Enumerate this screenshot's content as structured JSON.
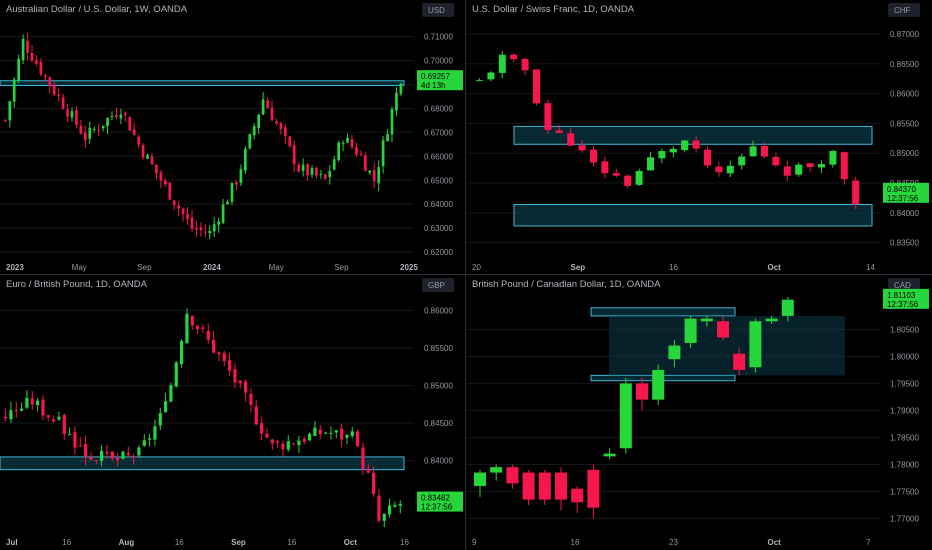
{
  "colors": {
    "up": "#26d63a",
    "down": "#f7164d",
    "zone_fill": "#0d4a5a",
    "zone_stroke": "#3fb8d8",
    "grid": "#14161c"
  },
  "charts": [
    {
      "title": "Australian Dollar / U.S. Dollar, 1W, OANDA",
      "currency": "USD",
      "yticks": [
        "0.71000",
        "0.70000",
        "0.69000",
        "0.68000",
        "0.67000",
        "0.66000",
        "0.65000",
        "0.64000",
        "0.63000",
        "0.62000"
      ],
      "ymin": 0.618,
      "ymax": 0.716,
      "xlabels": [
        {
          "t": "2023",
          "bold": true
        },
        {
          "t": "May"
        },
        {
          "t": "Sep"
        },
        {
          "t": "2024",
          "bold": true
        },
        {
          "t": "May"
        },
        {
          "t": "Sep"
        },
        {
          "t": "2025",
          "bold": true
        }
      ],
      "last_price": "0.69257",
      "countdown": "4d 13h",
      "zones": [
        {
          "from": 0.6895,
          "to": 0.6915
        }
      ],
      "seed": 7,
      "n": 90,
      "anchors": [
        [
          0,
          0.675
        ],
        [
          4,
          0.708
        ],
        [
          10,
          0.69
        ],
        [
          18,
          0.668
        ],
        [
          26,
          0.68
        ],
        [
          30,
          0.665
        ],
        [
          35,
          0.65
        ],
        [
          42,
          0.63
        ],
        [
          46,
          0.628
        ],
        [
          52,
          0.65
        ],
        [
          58,
          0.684
        ],
        [
          62,
          0.67
        ],
        [
          66,
          0.655
        ],
        [
          72,
          0.65
        ],
        [
          76,
          0.668
        ],
        [
          80,
          0.66
        ],
        [
          83,
          0.65
        ],
        [
          86,
          0.672
        ],
        [
          89,
          0.693
        ]
      ]
    },
    {
      "title": "U.S. Dollar / Swiss Franc, 1D, OANDA",
      "currency": "CHF",
      "yticks": [
        "0.87000",
        "0.86500",
        "0.86000",
        "0.85500",
        "0.85000",
        "0.84500",
        "0.84000",
        "0.83500"
      ],
      "ymin": 0.8326,
      "ymax": 0.872,
      "xlabels": [
        {
          "t": "20"
        },
        {
          "t": "Sep",
          "bold": true
        },
        {
          "t": "16"
        },
        {
          "t": "Oct",
          "bold": true
        },
        {
          "t": "14"
        }
      ],
      "last_price": "0.84370",
      "countdown": "12:37:56",
      "zones": [
        {
          "from": 0.8515,
          "to": 0.8545
        },
        {
          "from": 0.8378,
          "to": 0.8414
        }
      ],
      "seed": 11,
      "n": 34,
      "anchors": [
        [
          0,
          0.862
        ],
        [
          2,
          0.866
        ],
        [
          4,
          0.864
        ],
        [
          6,
          0.854
        ],
        [
          8,
          0.852
        ],
        [
          10,
          0.848
        ],
        [
          13,
          0.845
        ],
        [
          15,
          0.849
        ],
        [
          18,
          0.852
        ],
        [
          21,
          0.846
        ],
        [
          24,
          0.851
        ],
        [
          27,
          0.847
        ],
        [
          29,
          0.848
        ],
        [
          31,
          0.85
        ],
        [
          33,
          0.842
        ],
        [
          34,
          0.8437
        ]
      ]
    },
    {
      "title": "Euro / British Pound, 1D, OANDA",
      "currency": "GBP",
      "yticks": [
        "0.86000",
        "0.85500",
        "0.85000",
        "0.84500",
        "0.84000"
      ],
      "ymin": 0.8305,
      "ymax": 0.8618,
      "xlabels": [
        {
          "t": "Jul",
          "bold": true
        },
        {
          "t": "16"
        },
        {
          "t": "Aug",
          "bold": true
        },
        {
          "t": "16"
        },
        {
          "t": "Sep",
          "bold": true
        },
        {
          "t": "16"
        },
        {
          "t": "Oct",
          "bold": true
        },
        {
          "t": "16"
        }
      ],
      "last_price": "0.83482",
      "countdown": "12:37:56",
      "zones": [
        {
          "from": 0.8388,
          "to": 0.8405
        }
      ],
      "seed": 3,
      "n": 75,
      "anchors": [
        [
          0,
          0.846
        ],
        [
          5,
          0.848
        ],
        [
          10,
          0.845
        ],
        [
          15,
          0.841
        ],
        [
          20,
          0.84
        ],
        [
          25,
          0.841
        ],
        [
          30,
          0.847
        ],
        [
          34,
          0.86
        ],
        [
          38,
          0.856
        ],
        [
          42,
          0.852
        ],
        [
          46,
          0.847
        ],
        [
          50,
          0.842
        ],
        [
          55,
          0.843
        ],
        [
          60,
          0.844
        ],
        [
          65,
          0.843
        ],
        [
          68,
          0.838
        ],
        [
          70,
          0.832
        ],
        [
          73,
          0.834
        ],
        [
          75,
          0.8348
        ]
      ]
    },
    {
      "title": "British Pound / Canadian Dollar, 1D, OANDA",
      "currency": "CAD",
      "yticks": [
        "1.80500",
        "1.80000",
        "1.79500",
        "1.79000",
        "1.78500",
        "1.78000",
        "1.77500",
        "1.77000"
      ],
      "ymin": 1.7675,
      "ymax": 1.811,
      "xlabels": [
        {
          "t": "9"
        },
        {
          "t": "16"
        },
        {
          "t": "23"
        },
        {
          "t": "Oct",
          "bold": true
        },
        {
          "t": "7"
        }
      ],
      "last_price": "1.81103",
      "countdown": "12:37:56",
      "zones": [
        {
          "from": 1.8075,
          "to": 1.809
        },
        {
          "from": 1.7955,
          "to": 1.7965
        }
      ],
      "box": {
        "from": 1.7965,
        "to": 1.8075
      },
      "candles": [
        [
          1.776,
          1.7785,
          1.774,
          1.779
        ],
        [
          1.7785,
          1.7795,
          1.777,
          1.78
        ],
        [
          1.7795,
          1.7765,
          1.7755,
          1.78
        ],
        [
          1.7785,
          1.7735,
          1.7725,
          1.779
        ],
        [
          1.7785,
          1.7735,
          1.7725,
          1.779
        ],
        [
          1.7785,
          1.7735,
          1.7715,
          1.7795
        ],
        [
          1.7755,
          1.773,
          1.771,
          1.776
        ],
        [
          1.779,
          1.772,
          1.77,
          1.78
        ],
        [
          1.7815,
          1.782,
          1.781,
          1.783
        ],
        [
          1.783,
          1.795,
          1.782,
          1.796
        ],
        [
          1.795,
          1.792,
          1.79,
          1.796
        ],
        [
          1.792,
          1.7975,
          1.791,
          1.7985
        ],
        [
          1.7995,
          1.802,
          1.798,
          1.803
        ],
        [
          1.8025,
          1.807,
          1.8015,
          1.8075
        ],
        [
          1.8065,
          1.807,
          1.8055,
          1.8075
        ],
        [
          1.8065,
          1.8035,
          1.803,
          1.8075
        ],
        [
          1.8005,
          1.7975,
          1.7965,
          1.8015
        ],
        [
          1.798,
          1.8065,
          1.797,
          1.807
        ],
        [
          1.8065,
          1.807,
          1.806,
          1.8075
        ],
        [
          1.8075,
          1.8105,
          1.8065,
          1.811
        ]
      ]
    }
  ]
}
